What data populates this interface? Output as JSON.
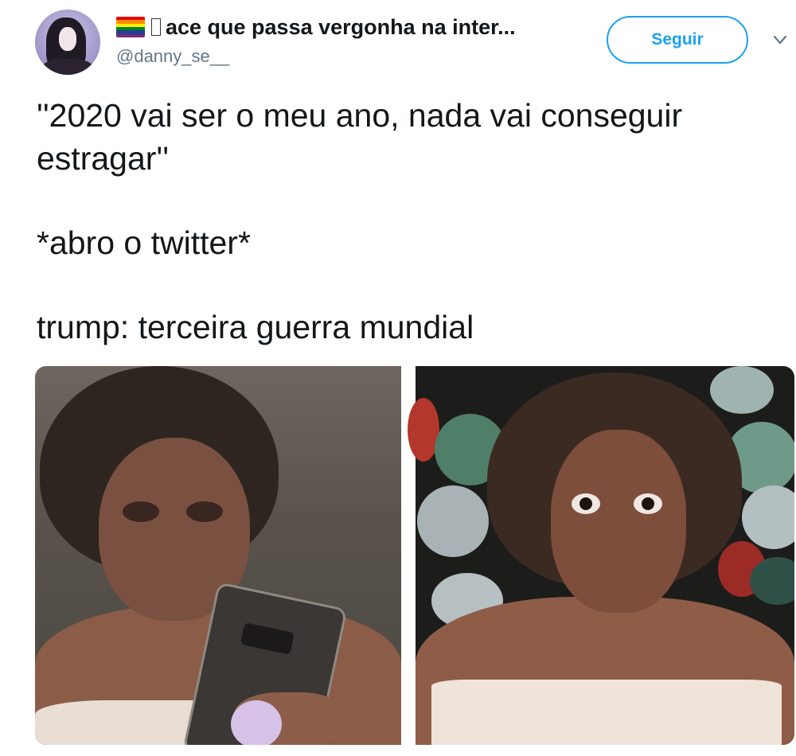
{
  "tweet": {
    "author": {
      "display_name": "ace que passa vergonha na inter...",
      "flag_icon": "rainbow-flag-icon",
      "handle": "@danny_se__",
      "avatar_icon": "avatar-image"
    },
    "follow_label": "Seguir",
    "menu_icon": "chevron-down-icon",
    "text_lines": [
      "''2020 vai ser o meu ano, nada vai conseguir estragar''",
      "*abro o twitter*",
      "trump: terceira guerra mundial"
    ],
    "media": {
      "left_image": "woman-looking-at-phone",
      "right_image": "woman-shocked-expression"
    }
  },
  "colors": {
    "accent": "#1da1f2",
    "text": "#14171a",
    "secondary_text": "#657786"
  }
}
